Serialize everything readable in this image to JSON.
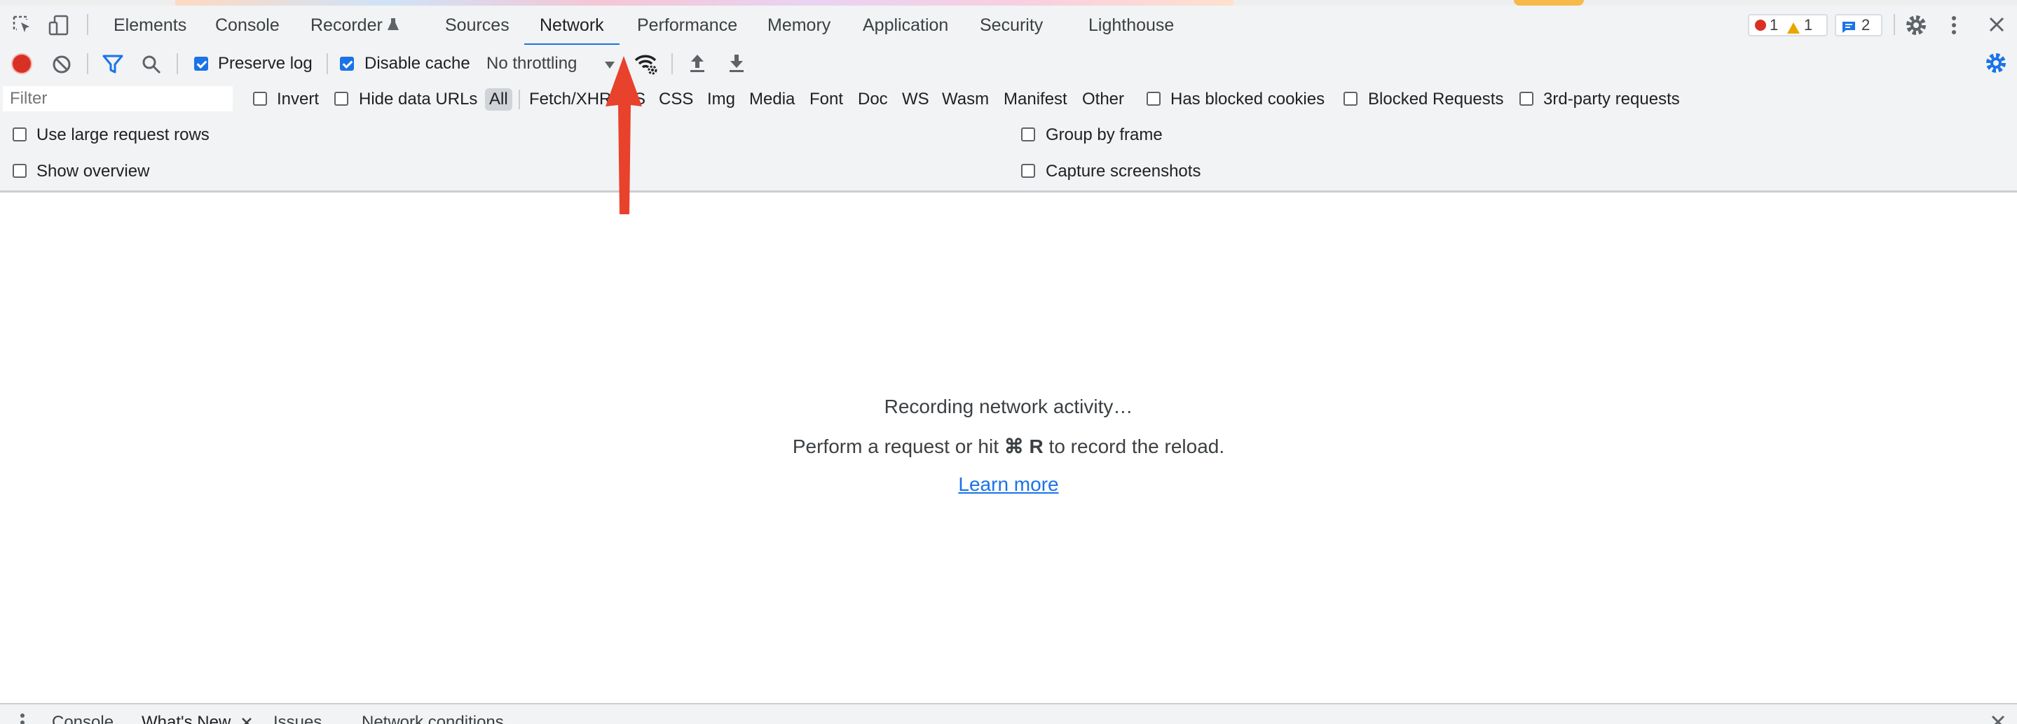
{
  "tabs": [
    {
      "label": "Elements"
    },
    {
      "label": "Console"
    },
    {
      "label": "Recorder"
    },
    {
      "label": "Sources"
    },
    {
      "label": "Network"
    },
    {
      "label": "Performance"
    },
    {
      "label": "Memory"
    },
    {
      "label": "Application"
    },
    {
      "label": "Security"
    },
    {
      "label": "Lighthouse"
    }
  ],
  "active_tab": "Network",
  "status": {
    "errors": "1",
    "warnings": "1",
    "messages": "2"
  },
  "toolbar": {
    "preserve_log": "Preserve log",
    "disable_cache": "Disable cache",
    "throttling": "No throttling"
  },
  "filter": {
    "placeholder": "Filter",
    "invert": "Invert",
    "hide_data_urls": "Hide data URLs",
    "types": [
      "All",
      "Fetch/XHR",
      "JS",
      "CSS",
      "Img",
      "Media",
      "Font",
      "Doc",
      "WS",
      "Wasm",
      "Manifest",
      "Other"
    ],
    "has_blocked_cookies": "Has blocked cookies",
    "blocked_requests": "Blocked Requests",
    "third_party": "3rd-party requests"
  },
  "settings": {
    "large_rows": "Use large request rows",
    "show_overview": "Show overview",
    "group_by_frame": "Group by frame",
    "capture_screenshots": "Capture screenshots"
  },
  "empty": {
    "recording": "Recording network activity…",
    "hint_prefix": "Perform a request or hit",
    "hint_key": "⌘ R",
    "hint_suffix": "to record the reload.",
    "learn_more": "Learn more"
  },
  "drawer": {
    "tabs": [
      "Console",
      "What's New",
      "Issues",
      "Network conditions"
    ]
  },
  "colors": {
    "accent": "#1a73e8",
    "record": "#d93025",
    "annotation_arrow": "#e8412c"
  }
}
